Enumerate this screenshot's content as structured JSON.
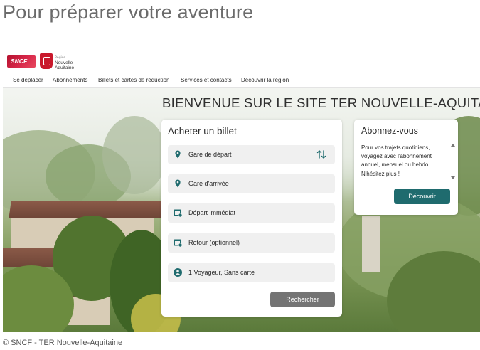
{
  "heading": "Pour préparer votre aventure",
  "brand": {
    "sncf_label": "SNCF",
    "region_small": "Région",
    "region_name_1": "Nouvelle-",
    "region_name_2": "Aquitaine"
  },
  "nav": {
    "items": [
      {
        "label": "Se déplacer"
      },
      {
        "label": "Abonnements"
      },
      {
        "label": "Billets et cartes de réduction"
      },
      {
        "label": "Services et contacts"
      },
      {
        "label": "Découvrir la région"
      }
    ]
  },
  "hero": {
    "title": "BIENVENUE SUR LE SITE TER NOUVELLE-AQUITAINE"
  },
  "ticket": {
    "title": "Acheter un billet",
    "departure_station": "Gare de départ",
    "arrival_station": "Gare d'arrivée",
    "departure_time": "Départ immédiat",
    "return": "Retour (optionnel)",
    "passengers": "1 Voyageur, Sans carte",
    "search_label": "Rechercher"
  },
  "subscribe": {
    "title": "Abonnez-vous",
    "text": "Pour vos trajets quotidiens, voyagez avec l'abonnement annuel, mensuel ou hebdo. N'hésitez plus !",
    "button_label": "Découvrir"
  },
  "caption": "© SNCF - TER Nouvelle-Aquitaine",
  "colors": {
    "accent": "#1f6b6e",
    "search_button": "#747474",
    "sncf_red": "#c9192c",
    "icon": "#1f6b6e"
  }
}
